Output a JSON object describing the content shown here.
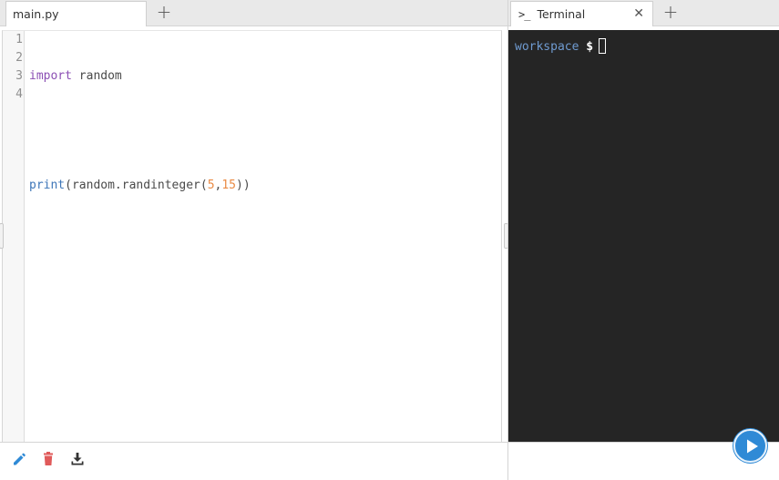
{
  "editor": {
    "tab_label": "main.py",
    "add_tab_label": "+",
    "line_numbers": [
      "1",
      "2",
      "3",
      "4"
    ],
    "code": {
      "line1_keyword": "import",
      "line1_rest": " random",
      "line3_fn": "print",
      "line3_open": "(random.randinteger(",
      "line3_arg1": "5",
      "line3_comma": ",",
      "line3_arg2": "15",
      "line3_close": "))"
    },
    "toolbar_icons": [
      "pencil-icon",
      "trash-icon",
      "download-icon"
    ]
  },
  "terminal": {
    "tab_icon": ">_",
    "tab_label": "Terminal",
    "close_label": "✕",
    "add_tab_label": "+",
    "prompt_dir": "workspace",
    "prompt_symbol": "$"
  },
  "run_button": {
    "icon": "play-icon"
  },
  "colors": {
    "accent": "#2f8ad6",
    "terminal_bg": "#252525",
    "keyword": "#8b4fb4",
    "function": "#3e76b8",
    "number": "#ea8b45",
    "delete": "#e05a5a"
  }
}
